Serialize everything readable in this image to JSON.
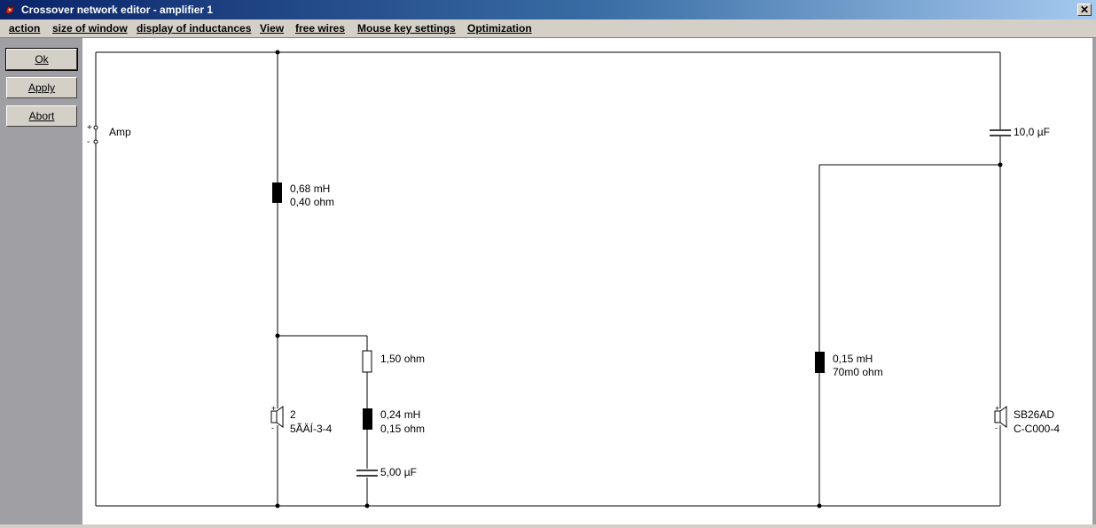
{
  "window": {
    "title": "Crossover network editor - amplifier 1",
    "close_symbol": "✕",
    "app_icon": "app-icon"
  },
  "menu": {
    "items": [
      {
        "label": "action"
      },
      {
        "label": "size of window"
      },
      {
        "label": "display of inductances"
      },
      {
        "label": "View"
      },
      {
        "label": "free wires"
      },
      {
        "label": "Mouse key settings"
      },
      {
        "label": "Optimization"
      }
    ]
  },
  "buttons": {
    "ok": "Ok",
    "apply": "Apply",
    "abort": "Abort"
  },
  "circuit": {
    "amp_label": "Amp",
    "amp_plus": "+",
    "amp_minus": "-",
    "inductor1": {
      "value": "0,68 mH",
      "resistance": "0,40 ohm"
    },
    "resistor1": {
      "value": "1,50 ohm"
    },
    "inductor2": {
      "value": "0,24 mH",
      "resistance": "0,15 ohm"
    },
    "capacitor1": {
      "value": "5,00 µF"
    },
    "speaker1": {
      "name": "2",
      "model": "5ÃÄÍ-3-4",
      "plus": "+",
      "minus": "-"
    },
    "capacitor2": {
      "value": "10,0 µF"
    },
    "inductor3": {
      "value": "0,15 mH",
      "resistance": "70m0 ohm"
    },
    "speaker2": {
      "name": "SB26AD",
      "model": "C-C000-4",
      "plus": "+",
      "minus": "-"
    }
  },
  "colors": {
    "wire": "#000000",
    "canvas": "#ffffff",
    "panel": "#a0a0a4"
  }
}
